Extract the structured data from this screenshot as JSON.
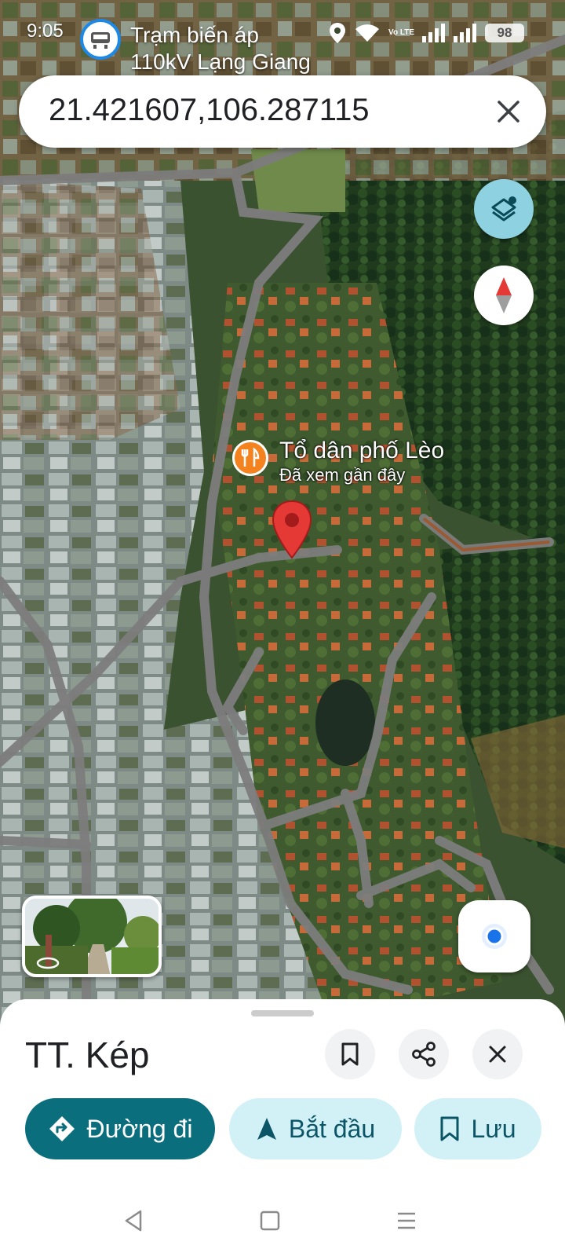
{
  "status_bar": {
    "time": "9:05",
    "notification_title_line1": "Trạm biến áp",
    "notification_title_line2": "110kV Lạng Giang",
    "network_label": "Vo LTE",
    "battery": "98"
  },
  "search": {
    "query": "21.421607,106.287115"
  },
  "map": {
    "place_name": "Tổ dân phố Lèo",
    "place_subtitle": "Đã xem gần đây",
    "poi_icon": "restaurant-icon",
    "colors": {
      "accent": "#0b6e7d",
      "accent_light": "#d2f1f7",
      "pin_red": "#e53935",
      "poi_orange": "#f4821f",
      "location_blue": "#1a73e8"
    }
  },
  "sheet": {
    "title": "TT. Kép",
    "directions_label": "Đường đi",
    "start_label": "Bắt đầu",
    "save_label": "Lưu"
  },
  "icons": {
    "layers": "layers-icon",
    "compass": "compass-icon",
    "my_location": "my-location-icon",
    "bookmark": "bookmark-icon",
    "share": "share-icon",
    "close": "close-icon",
    "directions": "directions-icon",
    "navigate": "navigation-arrow-icon",
    "back": "back-icon",
    "home": "home-icon",
    "menu": "menu-icon"
  }
}
